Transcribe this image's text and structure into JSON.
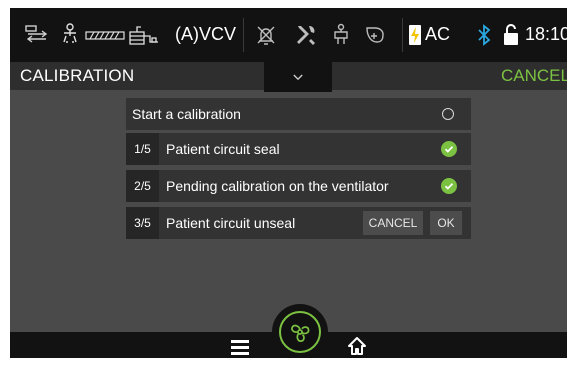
{
  "status_bar": {
    "icons": [
      "gas-exchange-icon",
      "patient-icon",
      "humidifier-filter-icon",
      "nebulizer-icon",
      "alarm-muted-icon",
      "tools-icon",
      "patient-connection-icon",
      "mask-icon",
      "battery-charging-icon",
      "bluetooth-icon",
      "unlocked-icon"
    ],
    "mode": "(A)VCV",
    "power": "AC",
    "time": "18:10"
  },
  "header": {
    "title": "CALIBRATION",
    "cancel_label": "CANCEL"
  },
  "calibration": {
    "start_label": "Start a calibration",
    "steps": [
      {
        "num": "1/5",
        "label": "Patient circuit seal",
        "status": "done"
      },
      {
        "num": "2/5",
        "label": "Pending calibration on the ventilator",
        "status": "done"
      },
      {
        "num": "3/5",
        "label": "Patient circuit unseal",
        "status": "pending",
        "cancel_label": "CANCEL",
        "ok_label": "OK"
      }
    ]
  },
  "bottom_bar": {
    "icons": [
      "menu-icon",
      "fan-icon",
      "home-icon"
    ]
  },
  "colors": {
    "accent": "#7cc242",
    "bluetooth": "#2aa7e0",
    "battery": "#f5c400"
  }
}
